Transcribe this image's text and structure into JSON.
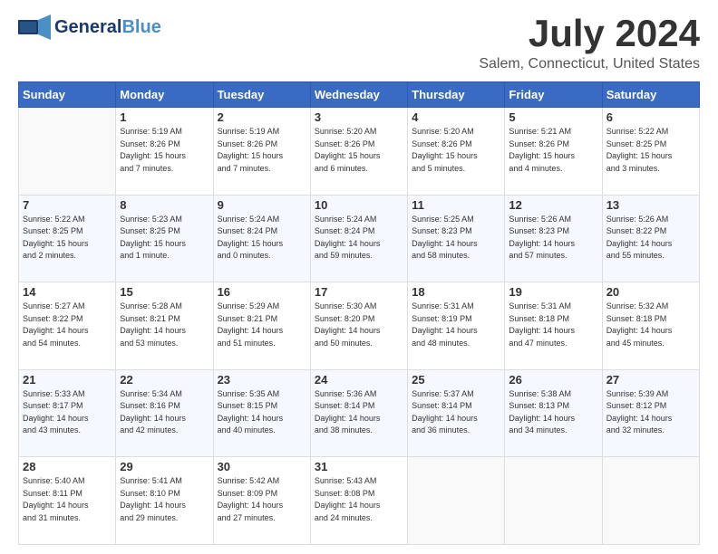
{
  "header": {
    "logo_general": "General",
    "logo_blue": "Blue",
    "month": "July 2024",
    "location": "Salem, Connecticut, United States"
  },
  "days_of_week": [
    "Sunday",
    "Monday",
    "Tuesday",
    "Wednesday",
    "Thursday",
    "Friday",
    "Saturday"
  ],
  "weeks": [
    [
      {
        "day": "",
        "info": ""
      },
      {
        "day": "1",
        "info": "Sunrise: 5:19 AM\nSunset: 8:26 PM\nDaylight: 15 hours\nand 7 minutes."
      },
      {
        "day": "2",
        "info": "Sunrise: 5:19 AM\nSunset: 8:26 PM\nDaylight: 15 hours\nand 7 minutes."
      },
      {
        "day": "3",
        "info": "Sunrise: 5:20 AM\nSunset: 8:26 PM\nDaylight: 15 hours\nand 6 minutes."
      },
      {
        "day": "4",
        "info": "Sunrise: 5:20 AM\nSunset: 8:26 PM\nDaylight: 15 hours\nand 5 minutes."
      },
      {
        "day": "5",
        "info": "Sunrise: 5:21 AM\nSunset: 8:26 PM\nDaylight: 15 hours\nand 4 minutes."
      },
      {
        "day": "6",
        "info": "Sunrise: 5:22 AM\nSunset: 8:25 PM\nDaylight: 15 hours\nand 3 minutes."
      }
    ],
    [
      {
        "day": "7",
        "info": "Sunrise: 5:22 AM\nSunset: 8:25 PM\nDaylight: 15 hours\nand 2 minutes."
      },
      {
        "day": "8",
        "info": "Sunrise: 5:23 AM\nSunset: 8:25 PM\nDaylight: 15 hours\nand 1 minute."
      },
      {
        "day": "9",
        "info": "Sunrise: 5:24 AM\nSunset: 8:24 PM\nDaylight: 15 hours\nand 0 minutes."
      },
      {
        "day": "10",
        "info": "Sunrise: 5:24 AM\nSunset: 8:24 PM\nDaylight: 14 hours\nand 59 minutes."
      },
      {
        "day": "11",
        "info": "Sunrise: 5:25 AM\nSunset: 8:23 PM\nDaylight: 14 hours\nand 58 minutes."
      },
      {
        "day": "12",
        "info": "Sunrise: 5:26 AM\nSunset: 8:23 PM\nDaylight: 14 hours\nand 57 minutes."
      },
      {
        "day": "13",
        "info": "Sunrise: 5:26 AM\nSunset: 8:22 PM\nDaylight: 14 hours\nand 55 minutes."
      }
    ],
    [
      {
        "day": "14",
        "info": "Sunrise: 5:27 AM\nSunset: 8:22 PM\nDaylight: 14 hours\nand 54 minutes."
      },
      {
        "day": "15",
        "info": "Sunrise: 5:28 AM\nSunset: 8:21 PM\nDaylight: 14 hours\nand 53 minutes."
      },
      {
        "day": "16",
        "info": "Sunrise: 5:29 AM\nSunset: 8:21 PM\nDaylight: 14 hours\nand 51 minutes."
      },
      {
        "day": "17",
        "info": "Sunrise: 5:30 AM\nSunset: 8:20 PM\nDaylight: 14 hours\nand 50 minutes."
      },
      {
        "day": "18",
        "info": "Sunrise: 5:31 AM\nSunset: 8:19 PM\nDaylight: 14 hours\nand 48 minutes."
      },
      {
        "day": "19",
        "info": "Sunrise: 5:31 AM\nSunset: 8:18 PM\nDaylight: 14 hours\nand 47 minutes."
      },
      {
        "day": "20",
        "info": "Sunrise: 5:32 AM\nSunset: 8:18 PM\nDaylight: 14 hours\nand 45 minutes."
      }
    ],
    [
      {
        "day": "21",
        "info": "Sunrise: 5:33 AM\nSunset: 8:17 PM\nDaylight: 14 hours\nand 43 minutes."
      },
      {
        "day": "22",
        "info": "Sunrise: 5:34 AM\nSunset: 8:16 PM\nDaylight: 14 hours\nand 42 minutes."
      },
      {
        "day": "23",
        "info": "Sunrise: 5:35 AM\nSunset: 8:15 PM\nDaylight: 14 hours\nand 40 minutes."
      },
      {
        "day": "24",
        "info": "Sunrise: 5:36 AM\nSunset: 8:14 PM\nDaylight: 14 hours\nand 38 minutes."
      },
      {
        "day": "25",
        "info": "Sunrise: 5:37 AM\nSunset: 8:14 PM\nDaylight: 14 hours\nand 36 minutes."
      },
      {
        "day": "26",
        "info": "Sunrise: 5:38 AM\nSunset: 8:13 PM\nDaylight: 14 hours\nand 34 minutes."
      },
      {
        "day": "27",
        "info": "Sunrise: 5:39 AM\nSunset: 8:12 PM\nDaylight: 14 hours\nand 32 minutes."
      }
    ],
    [
      {
        "day": "28",
        "info": "Sunrise: 5:40 AM\nSunset: 8:11 PM\nDaylight: 14 hours\nand 31 minutes."
      },
      {
        "day": "29",
        "info": "Sunrise: 5:41 AM\nSunset: 8:10 PM\nDaylight: 14 hours\nand 29 minutes."
      },
      {
        "day": "30",
        "info": "Sunrise: 5:42 AM\nSunset: 8:09 PM\nDaylight: 14 hours\nand 27 minutes."
      },
      {
        "day": "31",
        "info": "Sunrise: 5:43 AM\nSunset: 8:08 PM\nDaylight: 14 hours\nand 24 minutes."
      },
      {
        "day": "",
        "info": ""
      },
      {
        "day": "",
        "info": ""
      },
      {
        "day": "",
        "info": ""
      }
    ]
  ]
}
